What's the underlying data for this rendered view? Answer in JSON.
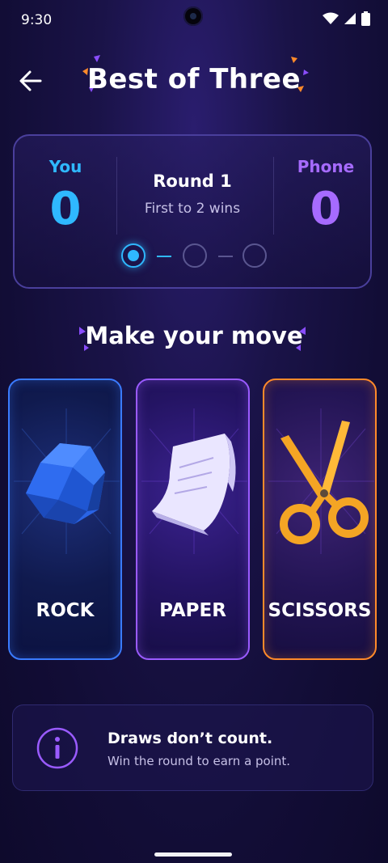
{
  "status_bar": {
    "time": "9:30"
  },
  "header": {
    "title": "Best of Three"
  },
  "score": {
    "player": {
      "label": "You",
      "score": "0",
      "color": "#2fb8ff"
    },
    "opponent": {
      "label": "Phone",
      "score": "0",
      "color": "#a66bff"
    },
    "round_label": "Round 1",
    "round_sub": "First to 2 wins",
    "rounds_total": 3,
    "current_round": 1
  },
  "move": {
    "heading": "Make your move",
    "options": [
      {
        "label": "ROCK",
        "icon": "rock-icon",
        "accent": "#3a7bff"
      },
      {
        "label": "PAPER",
        "icon": "paper-icon",
        "accent": "#9a5bff"
      },
      {
        "label": "SCISSORS",
        "icon": "scissors-icon",
        "accent": "#ff8a2a"
      }
    ]
  },
  "info": {
    "title": "Draws don’t count.",
    "subtitle": "Win the round to earn a point."
  }
}
